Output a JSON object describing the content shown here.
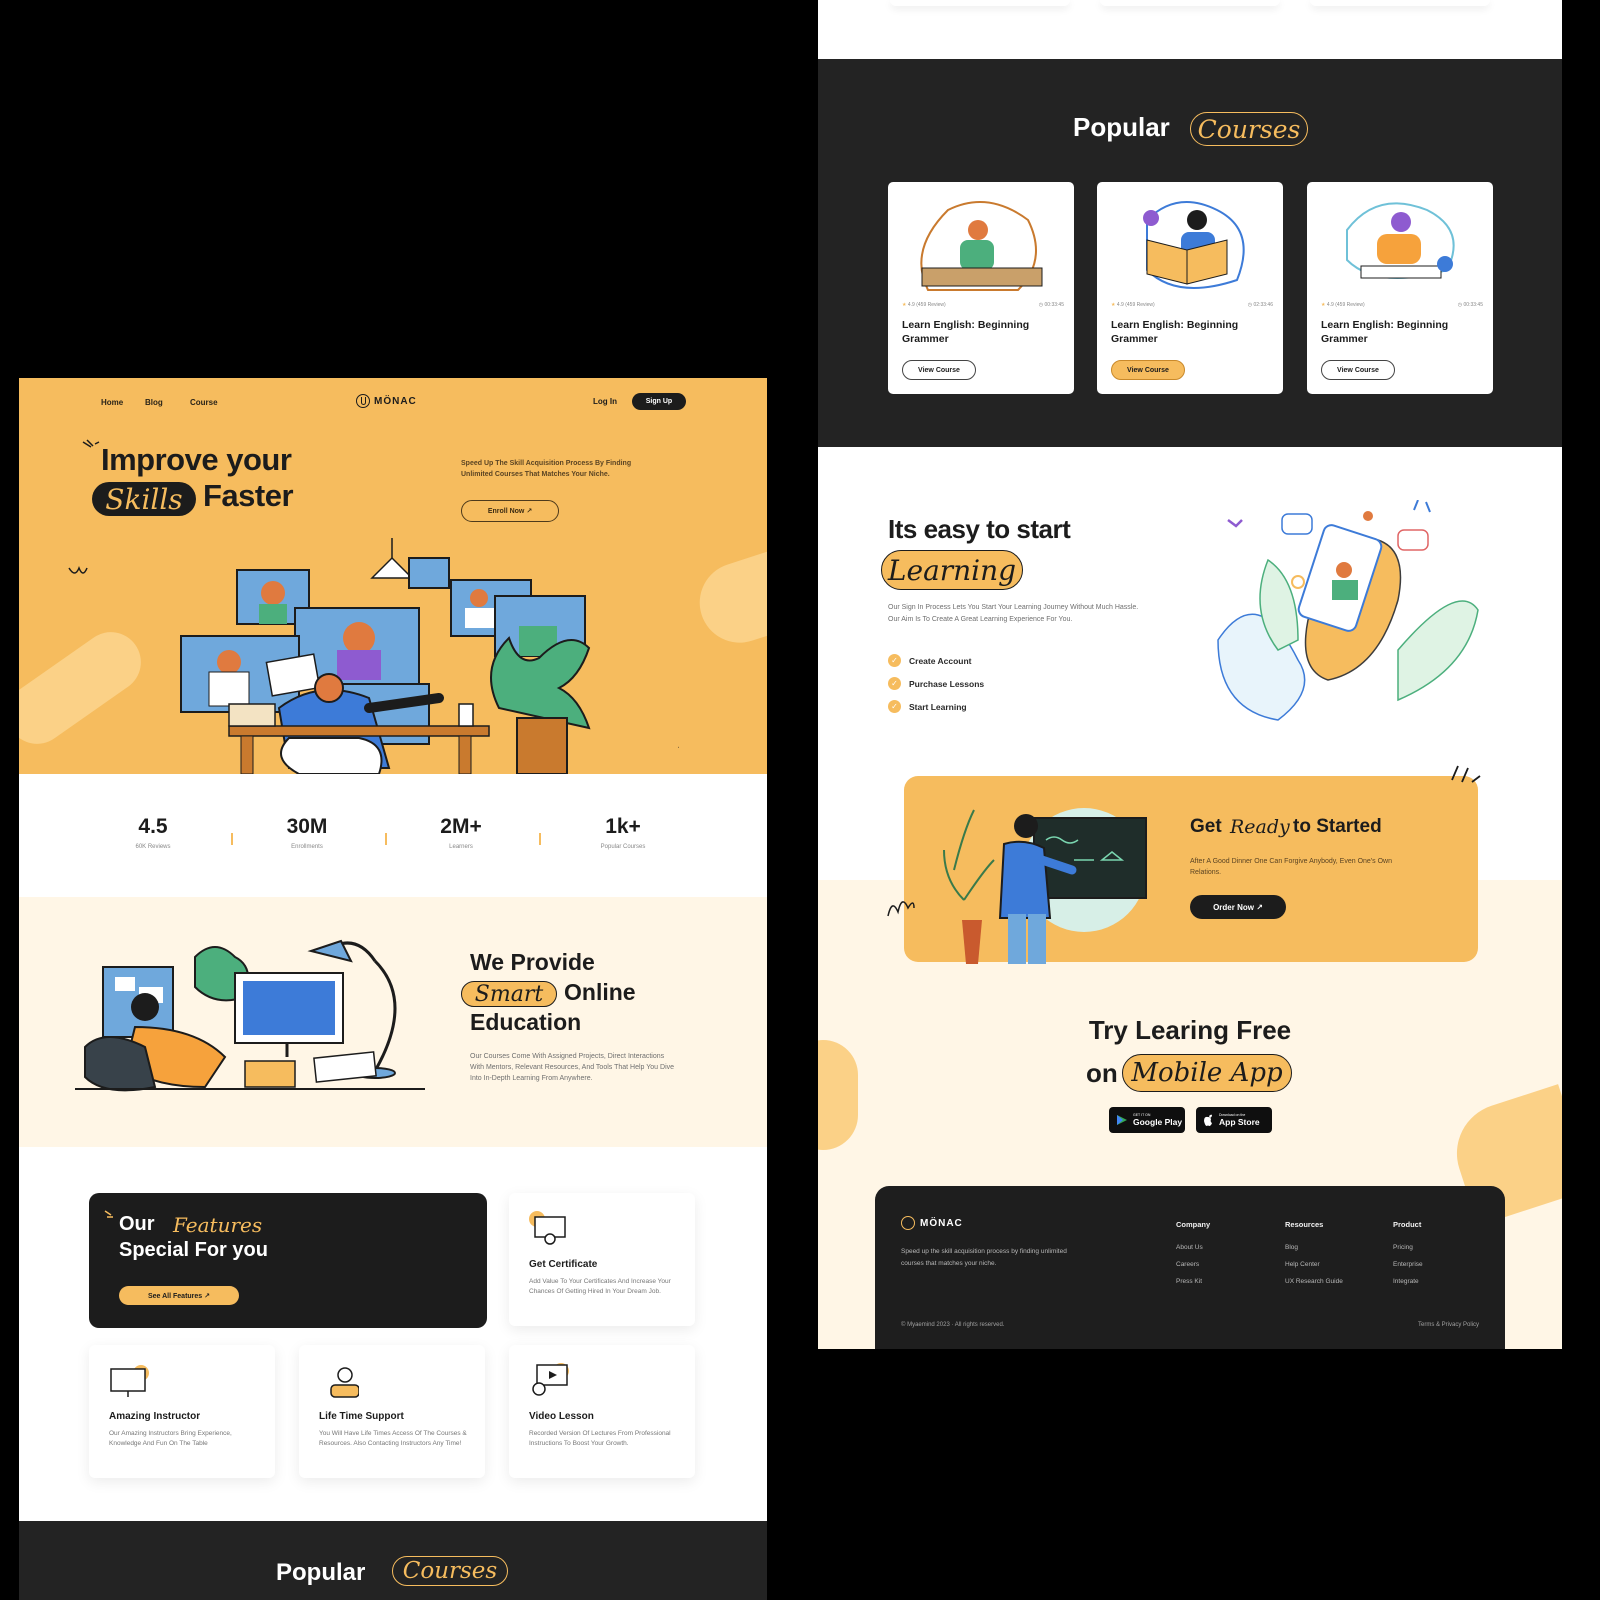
{
  "brand": {
    "name": "MÖNAC",
    "accent": "#f6bc5e",
    "dark": "#1c1c1c",
    "cream": "#fff6e6"
  },
  "nav": {
    "links": [
      "Home",
      "Blog",
      "Course"
    ],
    "login": "Log In",
    "signup": "Sign Up"
  },
  "hero": {
    "title_line1": "Improve your",
    "title_highlight": "Skills",
    "title_line2_rest": "Faster",
    "description": "Speed Up The Skill Acquisition Process By Finding Unlimited Courses That Matches Your Niche.",
    "cta": "Enroll Now ↗"
  },
  "stats": [
    {
      "value": "4.5",
      "label": "60K Reviews"
    },
    {
      "value": "30M",
      "label": "Enrollments"
    },
    {
      "value": "2M+",
      "label": "Learners"
    },
    {
      "value": "1k+",
      "label": "Popular Courses"
    }
  ],
  "provide": {
    "line1": "We Provide",
    "highlight": "Smart",
    "line2_rest": "Online",
    "line3": "Education",
    "description": "Our Courses Come With Assigned Projects, Direct Interactions With Mentors, Relevant Resources, And Tools That Help You Dive Into In-Depth Learning From Anywhere."
  },
  "features": {
    "title_word": "Our",
    "title_highlight": "Features",
    "title_line2": "Special For you",
    "cta": "See All Features ↗",
    "cards": [
      {
        "title": "Get Certificate",
        "desc": "Add Value To Your Certificates And Increase Your Chances Of Getting Hired In Your Dream Job."
      },
      {
        "title": "Amazing Instructor",
        "desc": "Our Amazing Instructors Bring Experience, Knowledge And Fun On The Table"
      },
      {
        "title": "Life Time Support",
        "desc": "You Will Have Life Times Access Of The Courses & Resources. Also Contacting Instructors Any Time!"
      },
      {
        "title": "Video Lesson",
        "desc": "Recorded Version Of Lectures From Professional Instructions To Boost Your Growth."
      }
    ]
  },
  "popular": {
    "word": "Popular",
    "highlight": "Courses",
    "courses": [
      {
        "rating": "4.9 (459 Review)",
        "duration": "00:33:45",
        "title": "Learn English: Beginning Grammer",
        "button": "View Course"
      },
      {
        "rating": "4.9 (459 Review)",
        "duration": "02:33:46",
        "title": "Learn English: Beginning Grammer",
        "button": "View Course"
      },
      {
        "rating": "4.9 (459 Review)",
        "duration": "00:33:45",
        "title": "Learn English: Beginning Grammer",
        "button": "View Course"
      }
    ]
  },
  "easy": {
    "title": "Its easy to start",
    "highlight": "Learning",
    "description": "Our Sign In Process Lets You Start Your Learning Journey Without Much Hassle. Our Aim Is To Create A Great Learning Experience For You.",
    "steps": [
      "Create Account",
      "Purchase Lessons",
      "Start Learning"
    ]
  },
  "ready": {
    "title_start": "Get",
    "title_highlight": "Ready",
    "title_end": "to Started",
    "description": "After A Good Dinner One Can Forgive Anybody, Even One's Own Relations.",
    "cta": "Order Now ↗"
  },
  "mobile": {
    "line1": "Try Learing Free",
    "line2_word": "on",
    "highlight": "Mobile App",
    "google_top": "GET IT ON",
    "google_name": "Google Play",
    "apple_top": "Download on the",
    "apple_name": "App Store"
  },
  "footer": {
    "description": "Speed up the skill acquisition process by finding unlimited courses that matches your niche.",
    "columns": [
      {
        "head": "Company",
        "links": [
          "About Us",
          "Careers",
          "Press Kit"
        ]
      },
      {
        "head": "Resources",
        "links": [
          "Blog",
          "Help Center",
          "UX Research Guide"
        ]
      },
      {
        "head": "Product",
        "links": [
          "Pricing",
          "Enterprise",
          "Integrate"
        ]
      }
    ],
    "copyright": "© Myaemind 2023 · All rights reserved.",
    "terms": "Terms & Privacy Policy"
  }
}
